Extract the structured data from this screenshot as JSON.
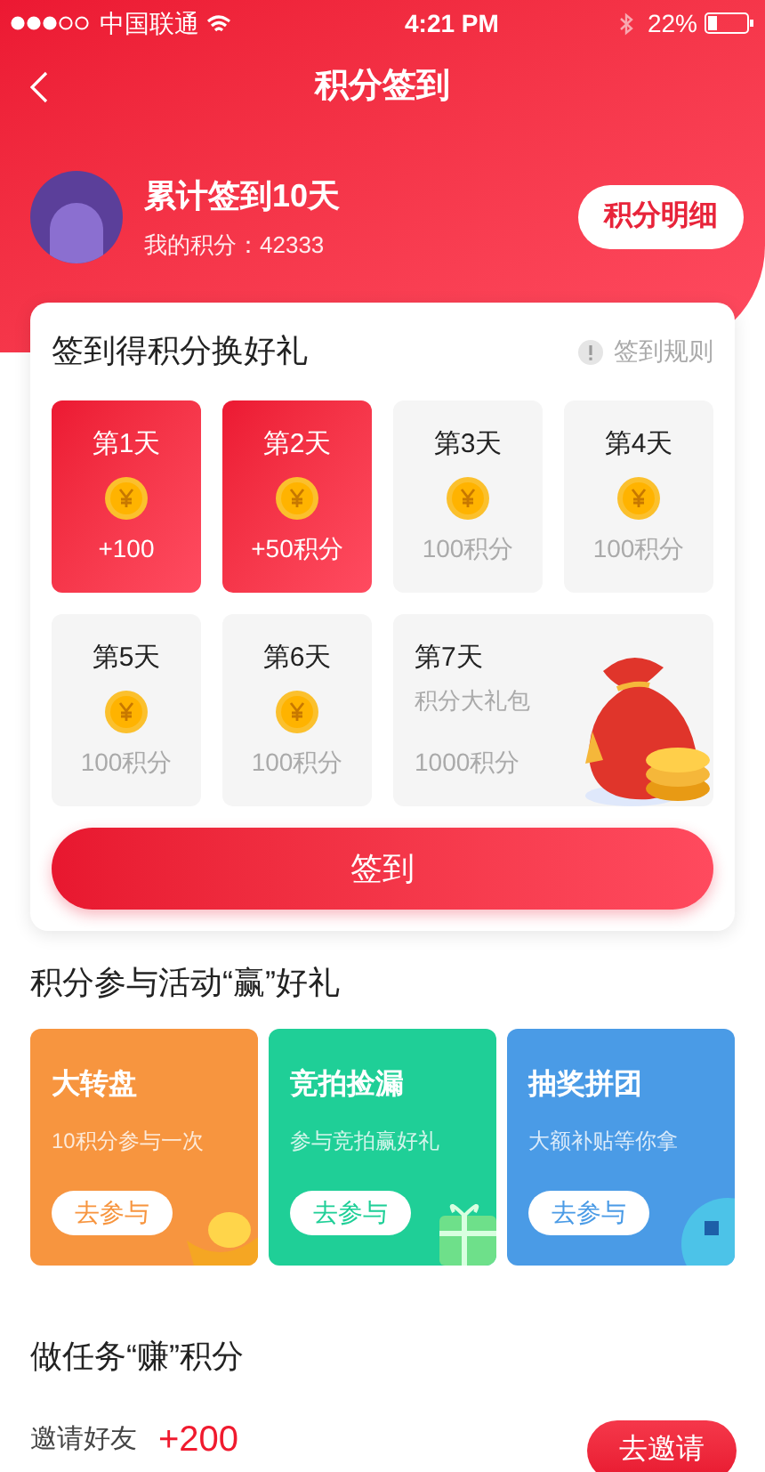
{
  "status_bar": {
    "carrier": "中国联通",
    "time": "4:21 PM",
    "battery": "22%"
  },
  "nav": {
    "title": "积分签到"
  },
  "profile": {
    "headline": "累计签到10天",
    "points": "我的积分：42333",
    "detail_button": "积分明细"
  },
  "checkin": {
    "title": "签到得积分换好礼",
    "rules": "签到规则",
    "days": [
      {
        "kind": "day",
        "label": "第1天",
        "reward": "+100",
        "signed": true
      },
      {
        "kind": "day",
        "label": "第2天",
        "reward": "+50积分",
        "signed": true
      },
      {
        "kind": "day",
        "label": "第3天",
        "reward": "100积分",
        "signed": false
      },
      {
        "kind": "day",
        "label": "第4天",
        "reward": "100积分",
        "signed": false
      },
      {
        "kind": "day",
        "label": "第5天",
        "reward": "100积分",
        "signed": false
      },
      {
        "kind": "day",
        "label": "第6天",
        "reward": "100积分",
        "signed": false
      },
      {
        "kind": "gift",
        "label": "第7天",
        "subtitle": "积分大礼包",
        "reward": "1000积分",
        "signed": false
      }
    ],
    "button": "签到"
  },
  "activities": {
    "title": "积分参与活动“赢”好礼",
    "items": [
      {
        "title": "大转盘",
        "subtitle": "10积分参与一次",
        "button": "去参与",
        "color": "#f7953f"
      },
      {
        "title": "竞拍捡漏",
        "subtitle": "参与竞拍赢好礼",
        "button": "去参与",
        "color": "#1fcf97"
      },
      {
        "title": "抽奖拼团",
        "subtitle": "大额补贴等你拿",
        "button": "去参与",
        "color": "#4a9be6"
      }
    ]
  },
  "tasks": {
    "title": "做任务“赚”积分",
    "items": [
      {
        "name": "邀请好友",
        "points": "+200",
        "button": "去邀请"
      }
    ]
  }
}
